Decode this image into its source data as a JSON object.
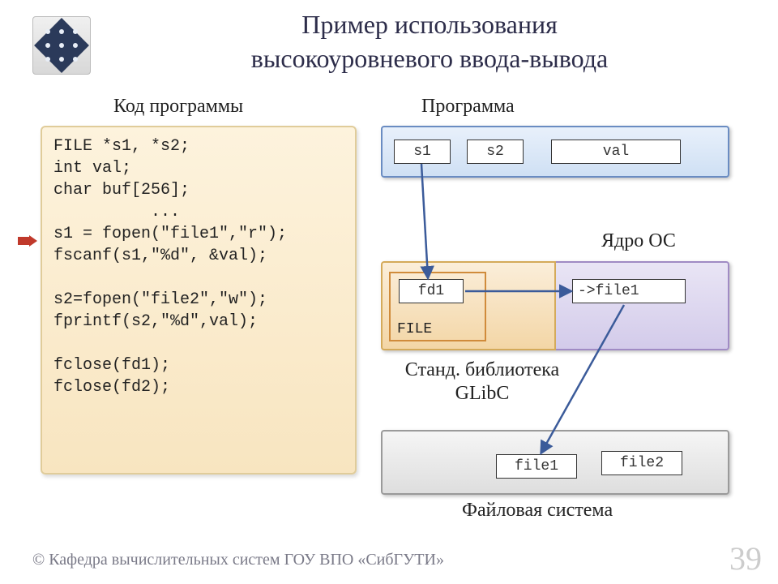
{
  "title_line1": "Пример использования",
  "title_line2": "высокоуровневого ввода-вывода",
  "sub_code": "Код программы",
  "sub_prog": "Программа",
  "code": "FILE *s1, *s2;\nint val;\nchar buf[256];\n          ...\ns1 = fopen(\"file1\",\"r\");\nfscanf(s1,\"%d\", &val);\n\ns2=fopen(\"file2\",\"w\");\nfprintf(s2,\"%d\",val);\n\nfclose(fd1);\nfclose(fd2);",
  "cells": {
    "s1": "s1",
    "s2": "s2",
    "val": "val",
    "fd1": "fd1",
    "FILE": "FILE",
    "ptr": "->file1",
    "file1": "file1",
    "file2": "file2"
  },
  "labels": {
    "kernel": "Ядро ОС",
    "glibc_l1": "Станд. библиотека",
    "glibc_l2": "GLibC",
    "fs": "Файловая система"
  },
  "footer": "© Кафедра вычислительных систем ГОУ ВПО «СибГУТИ»",
  "page": "39"
}
